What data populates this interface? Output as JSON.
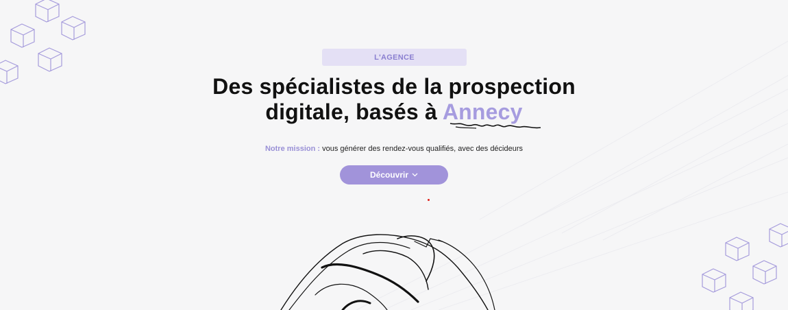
{
  "hero": {
    "badge": "L'AGENCE",
    "title_line1": "Des spécialistes de la prospection",
    "title_line2_prefix": "digitale, basés à ",
    "title_accent": "Annecy",
    "mission_label": "Notre mission :",
    "mission_text": " vous générer des rendez-vous qualifiés, avec des décideurs",
    "cta_label": "Découvrir"
  },
  "icons": {
    "cta_icon": "chevron-down-icon",
    "decor": [
      "cube-icon",
      "squiggle-underline",
      "hand-illustration"
    ]
  },
  "colors": {
    "accent": "#a69cdf",
    "badge_bg": "#e4e0f5",
    "button_bg": "#a193da",
    "heading": "#111111",
    "background": "#f6f6f7"
  }
}
